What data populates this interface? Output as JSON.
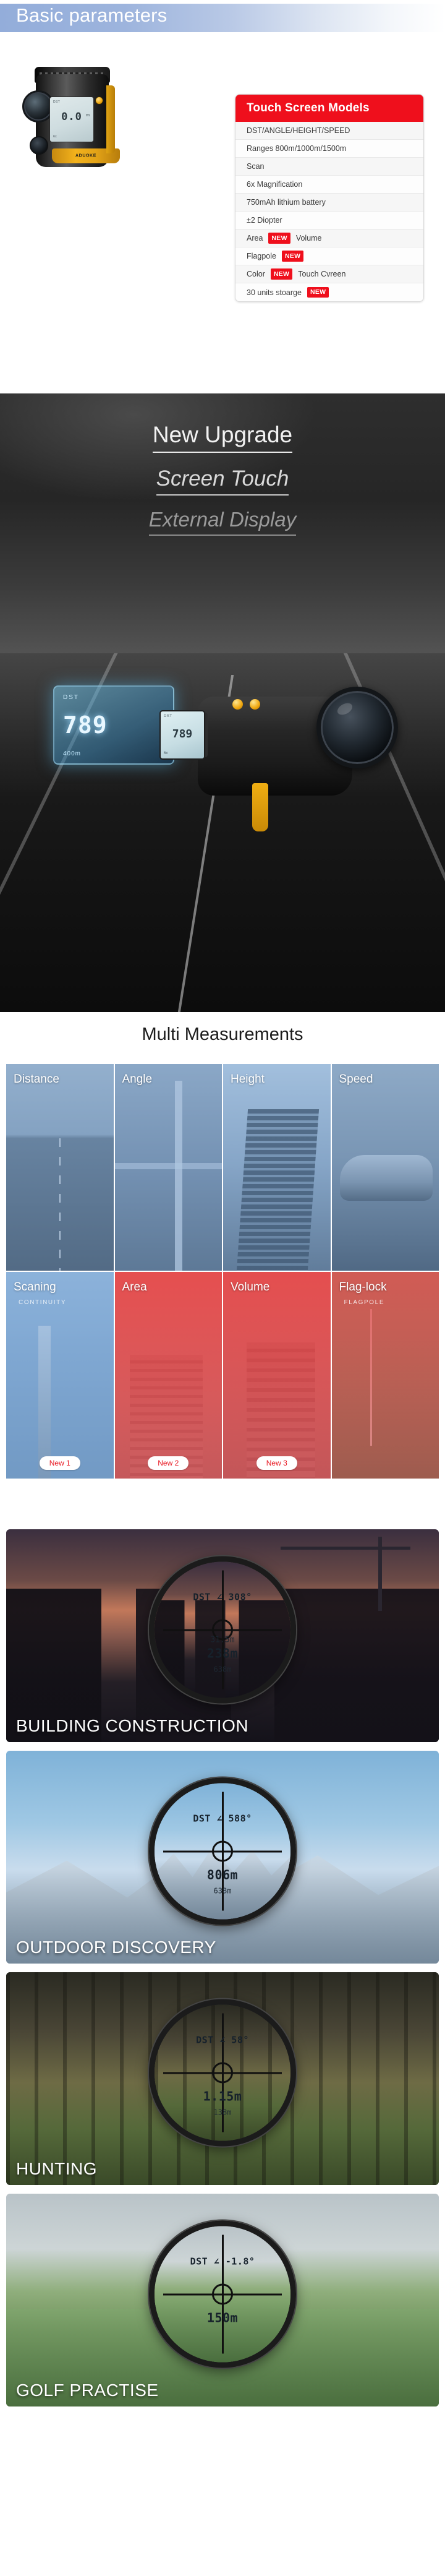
{
  "basic": {
    "section_title": "Basic parameters",
    "device": {
      "brand_label": "ADUOKE",
      "lcd_top": "DST",
      "lcd_value": "0.0",
      "lcd_unit": "m",
      "lcd_bottom": "6x"
    },
    "spec_card": {
      "header": "Touch Screen Models",
      "rows": [
        {
          "text": "DST/ANGLE/HEIGHT/SPEED",
          "badge": "",
          "tail": ""
        },
        {
          "text": "Ranges 800m/1000m/1500m",
          "badge": "",
          "tail": ""
        },
        {
          "text": "Scan",
          "badge": "",
          "tail": ""
        },
        {
          "text": "6x Magnification",
          "badge": "",
          "tail": ""
        },
        {
          "text": "750mAh lithium battery",
          "badge": "",
          "tail": ""
        },
        {
          "text": "±2 Diopter",
          "badge": "",
          "tail": ""
        },
        {
          "text": "Area",
          "badge": "NEW",
          "tail": "Volume"
        },
        {
          "text": "Flagpole",
          "badge": "NEW",
          "tail": ""
        },
        {
          "text": "Color",
          "badge": "NEW",
          "tail": "Touch Cvreen"
        },
        {
          "text": "30 units stoarge",
          "badge": "NEW",
          "tail": ""
        }
      ]
    }
  },
  "hero": {
    "line1": "New Upgrade",
    "line2": "Screen Touch",
    "line3": "External Display",
    "external_display": {
      "top_label": "DST",
      "value": "789",
      "unit": "m",
      "bottom_label": "400m"
    },
    "device_display": {
      "top_label": "DST",
      "value": "789",
      "unit": "m",
      "bottom_label": "6x"
    }
  },
  "multi": {
    "heading": "Multi Measurements",
    "tiles": [
      {
        "label": "Distance",
        "sub": "",
        "badge": "",
        "art": "art-road",
        "overlay": "ov-blue"
      },
      {
        "label": "Angle",
        "sub": "",
        "badge": "",
        "art": "art-bridge",
        "overlay": "ov-blue"
      },
      {
        "label": "Height",
        "sub": "",
        "badge": "",
        "art": "art-tower",
        "overlay": "ov-blue-l"
      },
      {
        "label": "Speed",
        "sub": "",
        "badge": "",
        "art": "art-car",
        "overlay": "ov-blue"
      },
      {
        "label": "Scaning",
        "sub": "CONTINUITY",
        "badge": "New 1",
        "art": "art-city",
        "overlay": "ov-blue-l"
      },
      {
        "label": "Area",
        "sub": "",
        "badge": "New 2",
        "art": "art-bldg",
        "overlay": "ov-red"
      },
      {
        "label": "Volume",
        "sub": "",
        "badge": "New 3",
        "art": "art-vol",
        "overlay": "ov-red"
      },
      {
        "label": "Flag-lock",
        "sub": "FLAGPOLE",
        "badge": "",
        "art": "art-golf",
        "overlay": "ov-red-s"
      }
    ]
  },
  "scenes": [
    {
      "caption": "BUILDING CONSTRUCTION",
      "bg": "bg-building",
      "readout_top": "DST ∠ 308°",
      "readout_mid": "31.5m",
      "readout_big": "238m",
      "readout_bot": "638m"
    },
    {
      "caption": "OUTDOOR DISCOVERY",
      "bg": "bg-outdoor",
      "readout_top": "DST ∠ 588°",
      "readout_mid": "",
      "readout_big": "806m",
      "readout_bot": "638m"
    },
    {
      "caption": "HUNTING",
      "bg": "bg-hunting",
      "readout_top": "DST ∠ 58°",
      "readout_mid": "",
      "readout_big": "1.15m",
      "readout_bot": "138m"
    },
    {
      "caption": "GOLF PRACTISE",
      "bg": "bg-golf",
      "readout_top": "DST ∠ -1.8°",
      "readout_mid": "",
      "readout_big": "150m",
      "readout_bot": ""
    }
  ]
}
